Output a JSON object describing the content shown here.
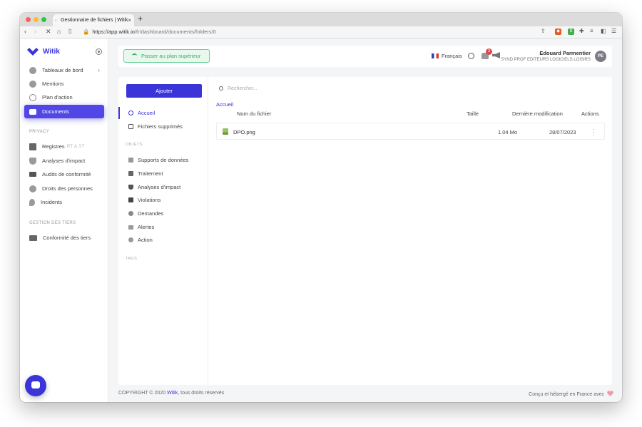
{
  "browser": {
    "tab_title": "Gestionnaire de fichiers | Witik",
    "url_host": "https://app.witik.io",
    "url_path": "/fr/dashboard/documents/folders/0"
  },
  "app": {
    "name": "Witik",
    "accent": "#3a34d9",
    "active_accent": "#5147e6"
  },
  "sidebar": {
    "items": [
      {
        "label": "Tableaux de bord",
        "icon": "dashboard-icon"
      },
      {
        "label": "Mentions",
        "icon": "chat-bubbles-icon"
      },
      {
        "label": "Plan d'action",
        "icon": "target-icon"
      },
      {
        "label": "Documents",
        "icon": "folder-icon"
      }
    ],
    "privacy_title": "PRIVACY",
    "privacy_items": [
      {
        "label": "Registres",
        "suffix": "RT & ST",
        "icon": "books-icon"
      },
      {
        "label": "Analyses d'impact",
        "icon": "shield-icon"
      },
      {
        "label": "Audits de conformité",
        "icon": "audit-icon"
      },
      {
        "label": "Droits des personnes",
        "icon": "person-icon"
      },
      {
        "label": "Incidents",
        "icon": "flame-icon"
      }
    ],
    "third_party_title": "GESTION DES TIERS",
    "third_party_items": [
      {
        "label": "Conformité des tiers",
        "icon": "network-icon"
      }
    ]
  },
  "topbar": {
    "upgrade_label": "Passer au plan supérieur",
    "language": "Français",
    "notif_count": "3",
    "user_name": "Edouard Parmentier",
    "user_org": "SYND PROF EDITEURS LOGICIELS LOISIRS",
    "avatar_initials": "PE"
  },
  "files": {
    "add_label": "Ajouter",
    "nav": [
      {
        "label": "Accueil",
        "icon": "star-icon"
      },
      {
        "label": "Fichiers supprimés",
        "icon": "trash-icon"
      }
    ],
    "objects_title": "OBJETS",
    "objects": [
      {
        "label": "Supports de données",
        "icon": "folder-icon"
      },
      {
        "label": "Traitement",
        "icon": "books-icon"
      },
      {
        "label": "Analyses d'impact",
        "icon": "shield-icon"
      },
      {
        "label": "Violations",
        "icon": "lock-icon"
      },
      {
        "label": "Demandes",
        "icon": "chat-icon"
      },
      {
        "label": "Alertes",
        "icon": "alert-icon"
      },
      {
        "label": "Action",
        "icon": "target-icon"
      }
    ],
    "tags_title": "TAGS",
    "search_placeholder": "Rechercher...",
    "breadcrumb": "Accueil",
    "columns": {
      "name": "Nom du fichier",
      "size": "Taille",
      "modified": "Dernière modification",
      "actions": "Actions"
    },
    "rows": [
      {
        "name": "DPO.png",
        "size": "1.04 Mo",
        "modified": "28/07/2023"
      }
    ]
  },
  "footer": {
    "copyright_prefix": "COPYRIGHT © 2020 ",
    "copyright_link": "Witik",
    "copyright_suffix": ", tous droits réservés",
    "right_text": "Conçu et hébergé en France avec"
  }
}
